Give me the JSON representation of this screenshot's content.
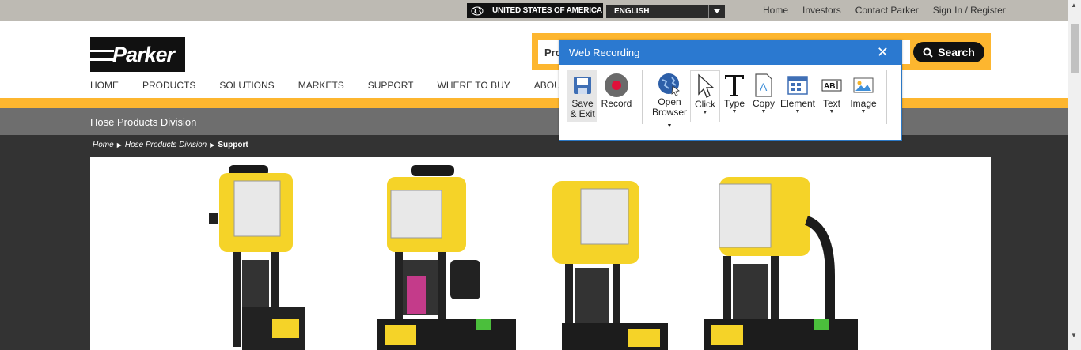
{
  "topbar": {
    "region": "UNITED STATES OF AMERICA",
    "language": "ENGLISH",
    "links": [
      "Home",
      "Investors",
      "Contact Parker",
      "Sign In / Register"
    ]
  },
  "logo": "Parker",
  "search": {
    "value": "Pro",
    "button": "Search"
  },
  "nav": [
    "HOME",
    "PRODUCTS",
    "SOLUTIONS",
    "MARKETS",
    "SUPPORT",
    "WHERE TO BUY",
    "ABOUT US"
  ],
  "division_title": "Hose Products Division",
  "breadcrumb": {
    "home": "Home",
    "division": "Hose Products Division",
    "current": "Support"
  },
  "dialog": {
    "title": "Web Recording",
    "tools": {
      "save_exit": "Save & Exit",
      "record": "Record",
      "open_browser_1": "Open",
      "open_browser_2": "Browser",
      "click": "Click",
      "type": "Type",
      "copy": "Copy",
      "element": "Element",
      "text": "Text",
      "image": "Image",
      "text_icon": "AB"
    }
  },
  "colors": {
    "accent_yellow": "#fdb62f",
    "dialog_blue": "#2b79d0",
    "record_red": "#e0103a"
  }
}
